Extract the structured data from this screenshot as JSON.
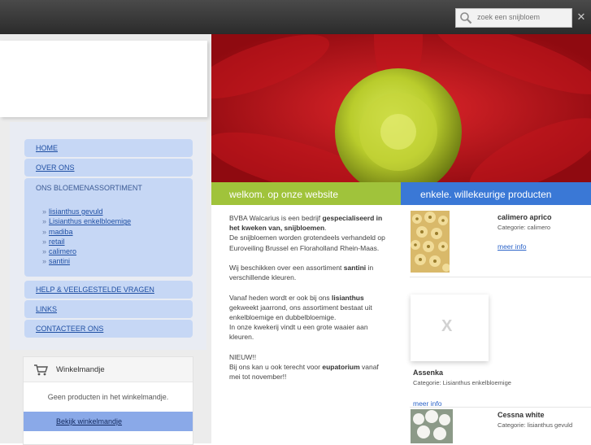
{
  "search": {
    "placeholder": "zoek een snijbloem",
    "button_icon": "x-icon"
  },
  "nav": {
    "home": "HOME",
    "about": "OVER ONS",
    "assortment": "ONS BLOEMENASSORTIMENT",
    "sub": [
      "lisianthus gevuld",
      "Lisianthus enkelbloemige",
      "madiba",
      "retail",
      "calimero",
      "santini"
    ],
    "help": "HELP & VEELGESTELDE VRAGEN",
    "links": "LINKS",
    "contact": "CONTACTEER ONS"
  },
  "cart": {
    "title": "Winkelmandje",
    "empty": "Geen producten in het winkelmandje.",
    "view": "Bekijk winkelmandje"
  },
  "welcome": {
    "heading": "welkom. op onze website",
    "p1_pre": "BVBA Walcarius is een bedrijf ",
    "p1_bold": "gespecialiseerd in het kweken van, snijbloemen",
    "p1_post": ".",
    "p2": "De snijbloemen worden grotendeels verhandeld op Euroveiling Brussel en Floraholland Rhein-Maas.",
    "p3_pre": "Wij beschikken over een assortiment ",
    "p3_bold": "santini",
    "p3_post": " in verschillende kleuren.",
    "p4_pre": "Vanaf heden wordt er ook bij ons ",
    "p4_bold": "lisianthus",
    "p4_post": " gekweekt jaarrond, ons assortiment bestaat uit enkelbloemige en dubbelbloemige.",
    "p5": "In onze kwekerij vindt u een grote waaier aan kleuren.",
    "p6": "NIEUW!!",
    "p7_pre": "Bij ons kan u ook terecht voor ",
    "p7_bold": "eupatorium",
    "p7_post": " vanaf mei tot november!!"
  },
  "products": {
    "heading": "enkele. willekeurige producten",
    "items": [
      {
        "name": "calimero aprico",
        "category": "Categorie: calimero",
        "more": "meer info"
      },
      {
        "name": "Assenka",
        "category": "Categorie: Lisianthus enkelbloemige",
        "more": "meer info"
      },
      {
        "name": "Cessna white",
        "category": "Categorie: lisianthus gevuld"
      }
    ],
    "placeholder_mark": "X"
  },
  "colors": {
    "green_bar": "#a0c33b",
    "blue_bar": "#3a78d6",
    "nav_item": "#c6d7f5",
    "cart_view": "#8aa9e8"
  }
}
